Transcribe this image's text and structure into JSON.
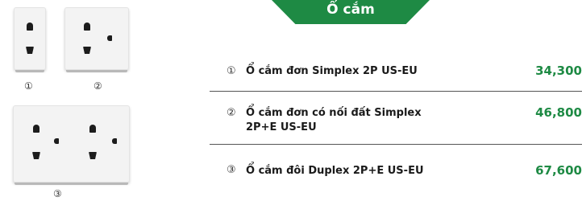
{
  "header": {
    "title": "Ổ cắm"
  },
  "products": [
    {
      "number": "①",
      "name": "Ổ cắm đơn Simplex 2P US-EU",
      "price": "34,300"
    },
    {
      "number": "②",
      "name": "Ổ cắm đơn có nối đất Simplex 2P+E US-EU",
      "price": "46,800"
    },
    {
      "number": "③",
      "name": "Ổ cắm đôi Duplex 2P+E US-EU",
      "price": "67,600"
    }
  ],
  "image_labels": [
    "①",
    "②",
    "③"
  ],
  "colors": {
    "accent": "#1e8a44",
    "text": "#1a1a1a",
    "divider": "#555555"
  }
}
